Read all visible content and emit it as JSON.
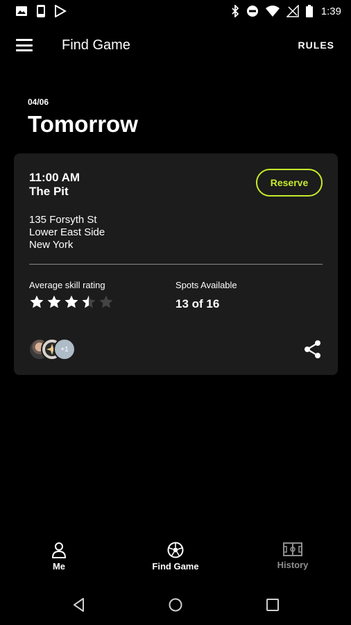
{
  "status_bar": {
    "time": "1:39"
  },
  "app_bar": {
    "title": "Find Game",
    "rules_label": "RULES"
  },
  "schedule": {
    "date": "04/06",
    "day_label": "Tomorrow"
  },
  "game": {
    "time": "11:00 AM",
    "venue": "The Pit",
    "reserve_label": "Reserve",
    "address_line1": "135 Forsyth St",
    "address_line2": "Lower East Side",
    "address_line3": "New York",
    "skill_label": "Average skill rating",
    "skill_rating": 3.5,
    "skill_max": 5,
    "spots_label": "Spots Available",
    "spots_value": "13 of 16",
    "extra_players_badge": "+1"
  },
  "bottom_nav": {
    "items": [
      {
        "label": "Me",
        "icon": "person-icon"
      },
      {
        "label": "Find Game",
        "icon": "soccer-ball-icon"
      },
      {
        "label": "History",
        "icon": "field-icon"
      }
    ]
  },
  "colors": {
    "accent": "#c6ea2b",
    "card": "#1c1c1c",
    "background": "#000000",
    "inactive": "#8e8e8e"
  }
}
